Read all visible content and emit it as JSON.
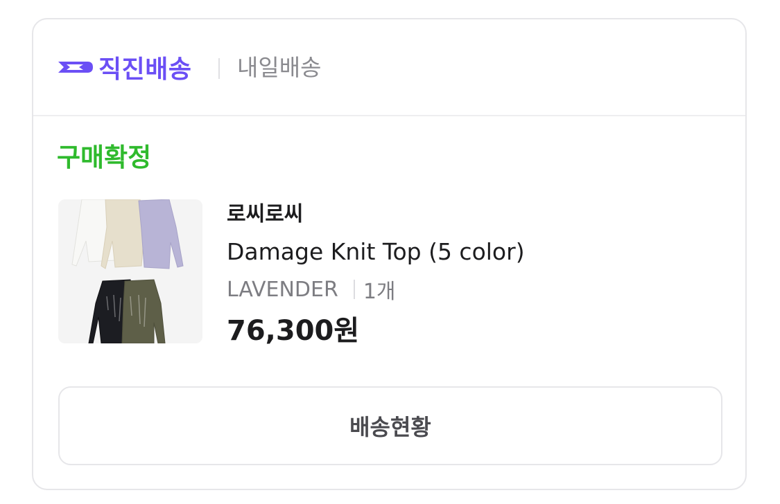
{
  "header": {
    "badge_label": "직진배송",
    "badge_icon": "delivery-arrow-icon",
    "badge_color": "#6b4ff5",
    "secondary_label": "내일배송"
  },
  "order": {
    "status": "구매확정",
    "status_color": "#2fba2d"
  },
  "product": {
    "brand": "로씨로씨",
    "name": "Damage Knit Top (5 color)",
    "option": "LAVENDER",
    "quantity": "1개",
    "price": "76,300원"
  },
  "actions": {
    "track_label": "배송현황"
  }
}
